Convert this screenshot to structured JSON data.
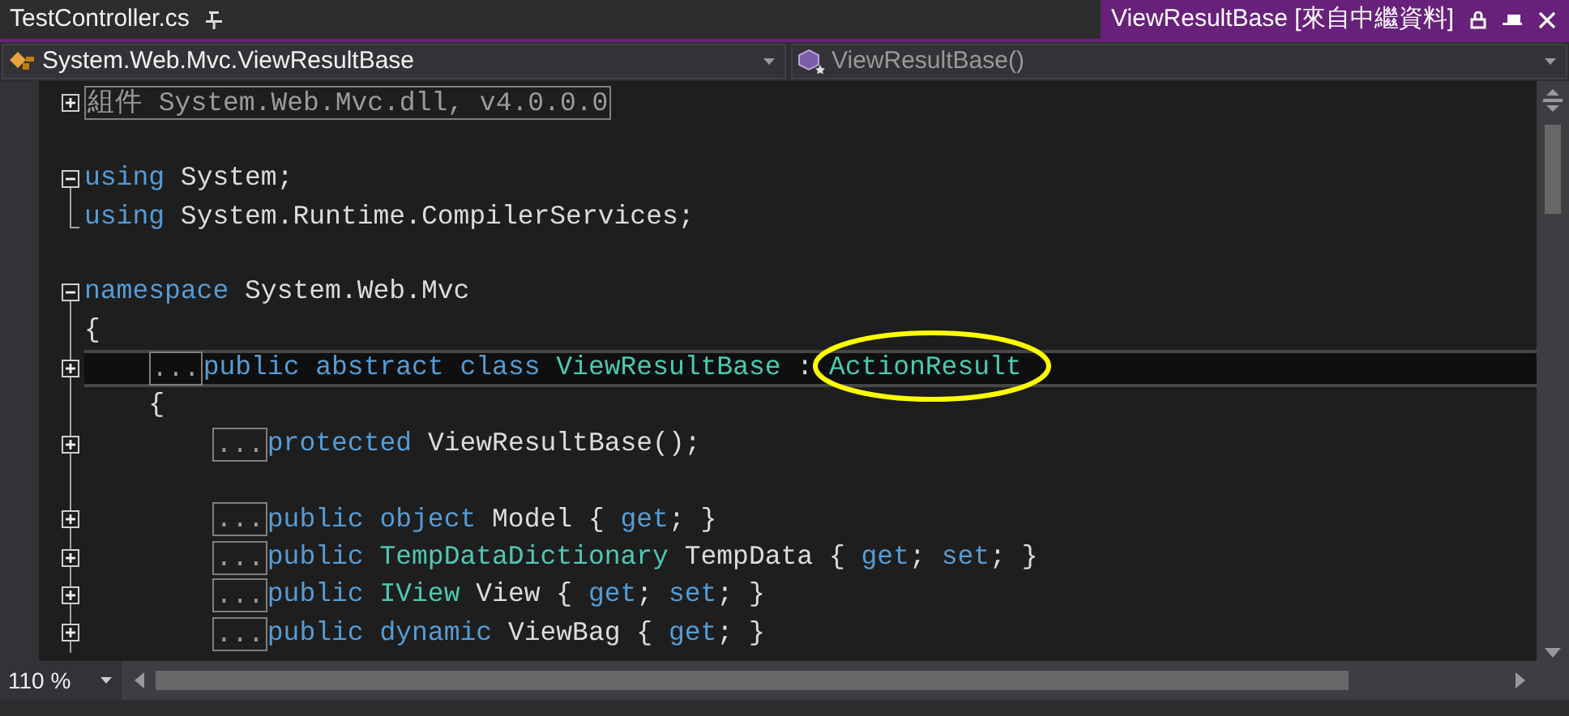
{
  "tabs": [
    {
      "label": "TestController.cs",
      "selected": false
    },
    {
      "label": "ViewResultBase [來自中繼資料]",
      "selected": true
    }
  ],
  "navigation": {
    "type_dropdown": "System.Web.Mvc.ViewResultBase",
    "member_dropdown": "ViewResultBase()"
  },
  "code_lines": [
    {
      "kind": "plus",
      "region": "組件 System.Web.Mvc.dll, v4.0.0.0"
    },
    {
      "kind": "none"
    },
    {
      "kind": "minus",
      "tokens": [
        {
          "kind": "keyword",
          "text": "using"
        },
        {
          "kind": "plain",
          "text": " System;"
        }
      ]
    },
    {
      "kind": "end",
      "tokens": [
        {
          "kind": "keyword",
          "text": "using"
        },
        {
          "kind": "plain",
          "text": " System.Runtime.CompilerServices;"
        }
      ]
    },
    {
      "kind": "none"
    },
    {
      "kind": "minus",
      "tokens": [
        {
          "kind": "keyword",
          "text": "namespace"
        },
        {
          "kind": "plain",
          "text": " System.Web.Mvc"
        }
      ]
    },
    {
      "kind": "line",
      "tokens": [
        {
          "kind": "plain",
          "text": "{"
        }
      ],
      "children": [
        {
          "kind": "plus-in",
          "current": true,
          "collapsed": "...",
          "tokens": [
            {
              "kind": "keyword",
              "text": "public abstract class "
            },
            {
              "kind": "type",
              "text": "ViewResultBase"
            },
            {
              "kind": "plain",
              "text": " : "
            },
            {
              "kind": "type",
              "text": "ActionResult",
              "circled": true
            }
          ]
        },
        {
          "kind": "line",
          "tokens": [
            {
              "kind": "plain",
              "text": "{"
            }
          ],
          "children": [
            {
              "kind": "plus-in",
              "collapsed": "...",
              "tokens": [
                {
                  "kind": "keyword",
                  "text": "protected "
                },
                {
                  "kind": "plain",
                  "text": "ViewResultBase();"
                }
              ]
            },
            {
              "kind": "line"
            },
            {
              "kind": "plus-in",
              "collapsed": "...",
              "tokens": [
                {
                  "kind": "keyword",
                  "text": "public object "
                },
                {
                  "kind": "plain",
                  "text": "Model { "
                },
                {
                  "kind": "keyword",
                  "text": "get"
                },
                {
                  "kind": "plain",
                  "text": "; }"
                }
              ]
            },
            {
              "kind": "plus-in",
              "collapsed": "...",
              "tokens": [
                {
                  "kind": "keyword",
                  "text": "public "
                },
                {
                  "kind": "type",
                  "text": "TempDataDictionary"
                },
                {
                  "kind": "plain",
                  "text": " TempData { "
                },
                {
                  "kind": "keyword",
                  "text": "get"
                },
                {
                  "kind": "plain",
                  "text": "; "
                },
                {
                  "kind": "keyword",
                  "text": "set"
                },
                {
                  "kind": "plain",
                  "text": "; }"
                }
              ]
            },
            {
              "kind": "plus-in",
              "collapsed": "...",
              "tokens": [
                {
                  "kind": "keyword",
                  "text": "public "
                },
                {
                  "kind": "type",
                  "text": "IView"
                },
                {
                  "kind": "plain",
                  "text": " View { "
                },
                {
                  "kind": "keyword",
                  "text": "get"
                },
                {
                  "kind": "plain",
                  "text": "; "
                },
                {
                  "kind": "keyword",
                  "text": "set"
                },
                {
                  "kind": "plain",
                  "text": "; }"
                }
              ]
            },
            {
              "kind": "plus-in",
              "collapsed": "...",
              "tokens": [
                {
                  "kind": "keyword",
                  "text": "public dynamic "
                },
                {
                  "kind": "plain",
                  "text": "ViewBag { "
                },
                {
                  "kind": "keyword",
                  "text": "get"
                },
                {
                  "kind": "plain",
                  "text": "; }"
                }
              ]
            }
          ]
        }
      ]
    }
  ],
  "zoom": "110 %"
}
